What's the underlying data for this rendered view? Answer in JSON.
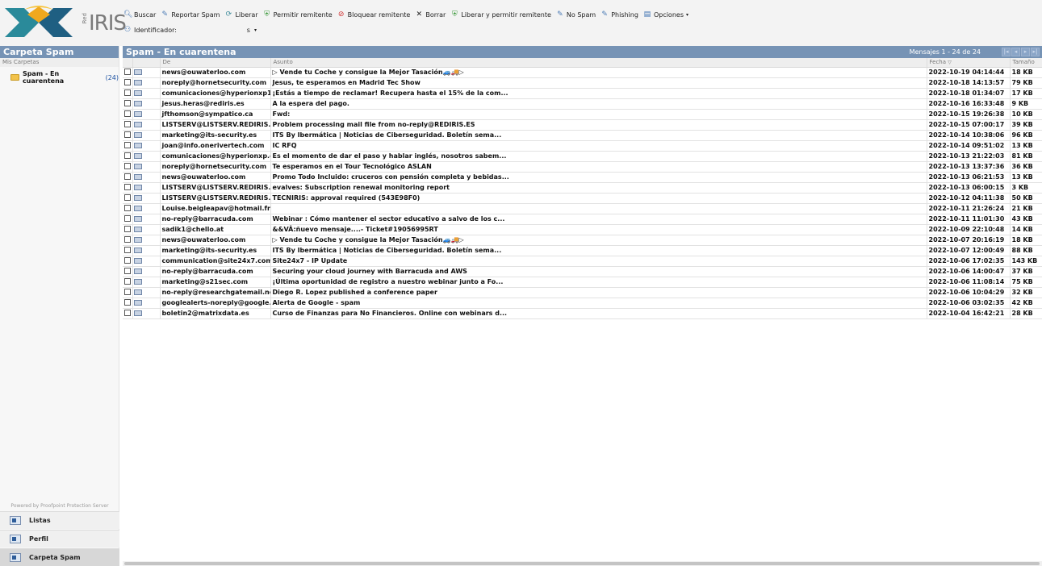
{
  "brand": {
    "name": "IRIS",
    "prefix": "Red"
  },
  "toolbar": {
    "buscar": "Buscar",
    "reportar": "Reportar Spam",
    "liberar": "Liberar",
    "permitir": "Permitir remitente",
    "bloquear": "Bloquear remitente",
    "borrar": "Borrar",
    "liberar_permitir": "Liberar y permitir remitente",
    "no_spam": "No Spam",
    "phishing": "Phishing",
    "opciones": "Opciones",
    "ident_label": "Identificador:",
    "ident_value": "s"
  },
  "left": {
    "title": "Carpeta Spam",
    "subtitle": "Mis Carpetas",
    "folder_name": "Spam - En cuarentena",
    "folder_count": "(24)",
    "powered": "Powered by Proofpoint Protection Server",
    "nav": [
      "Listas",
      "Perfil",
      "Carpeta Spam"
    ]
  },
  "main": {
    "title": "Spam - En cuarentena",
    "count": "Mensajes 1 - 24 de 24",
    "columns": {
      "from": "De",
      "subject": "Asunto",
      "date": "Fecha",
      "size": "Tamaño"
    },
    "rows": [
      {
        "from": "news@ouwaterloo.com",
        "subject": "▷ Vende tu Coche y consigue la Mejor Tasación🚙🚚▷",
        "date": "2022-10-19 04:14:44",
        "size": "18 KB"
      },
      {
        "from": "noreply@hornetsecurity.com",
        "subject": "Jesus,   te esperamos en Madrid Tec Show",
        "date": "2022-10-18 14:13:57",
        "size": "79 KB"
      },
      {
        "from": "comunicaciones@hyperionxp1.com",
        "subject": "¡Estás a tiempo de reclamar! Recupera hasta el 15% de la com...",
        "date": "2022-10-18 01:34:07",
        "size": "17 KB"
      },
      {
        "from": "jesus.heras@rediris.es",
        "subject": "A la espera del pago.",
        "date": "2022-10-16 16:33:48",
        "size": "9 KB"
      },
      {
        "from": "jfthomson@sympatico.ca",
        "subject": "Fwd:",
        "date": "2022-10-15 19:26:38",
        "size": "10 KB"
      },
      {
        "from": "LISTSERV@LISTSERV.REDIRIS.ES",
        "subject": "Problem processing mail file from no-reply@REDIRIS.ES",
        "date": "2022-10-15 07:00:17",
        "size": "39 KB"
      },
      {
        "from": "marketing@its-security.es",
        "subject": "ITS By Ibermática | Noticias de Ciberseguridad. Boletín sema...",
        "date": "2022-10-14 10:38:06",
        "size": "96 KB"
      },
      {
        "from": "joan@info.onerivertech.com",
        "subject": "IC RFQ",
        "date": "2022-10-14 09:51:02",
        "size": "13 KB"
      },
      {
        "from": "comunicaciones@hyperionxp.com",
        "subject": "Es el momento de dar el paso y hablar inglés, nosotros sabem...",
        "date": "2022-10-13 21:22:03",
        "size": "81 KB"
      },
      {
        "from": "noreply@hornetsecurity.com",
        "subject": "Te esperamos en el Tour Tecnológico ASLAN",
        "date": "2022-10-13 13:37:36",
        "size": "36 KB"
      },
      {
        "from": "news@ouwaterloo.com",
        "subject": "Promo Todo Incluido: cruceros con pensión completa y bebidas...",
        "date": "2022-10-13 06:21:53",
        "size": "13 KB"
      },
      {
        "from": "LISTSERV@LISTSERV.REDIRIS.ES",
        "subject": "evalves: Subscription renewal monitoring report",
        "date": "2022-10-13 06:00:15",
        "size": "3 KB"
      },
      {
        "from": "LISTSERV@LISTSERV.REDIRIS.ES",
        "subject": "TECNIRIS: approval required (543E98F0)",
        "date": "2022-10-12 04:11:38",
        "size": "50 KB"
      },
      {
        "from": "Louise.beigleapav@hotmail.fr",
        "subject": "",
        "date": "2022-10-11 21:26:24",
        "size": "21 KB"
      },
      {
        "from": "no-reply@barracuda.com",
        "subject": "Webinar : Cómo mantener el sector educativo a salvo de los c...",
        "date": "2022-10-11 11:01:30",
        "size": "43 KB"
      },
      {
        "from": "sadik1@chello.at",
        "subject": "&&VÂ:ñuevo mensaje....- Ticket#19056995RT",
        "date": "2022-10-09 22:10:48",
        "size": "14 KB"
      },
      {
        "from": "news@ouwaterloo.com",
        "subject": "▷ Vende tu Coche y consigue la Mejor Tasación🚙🚚▷",
        "date": "2022-10-07 20:16:19",
        "size": "18 KB"
      },
      {
        "from": "marketing@its-security.es",
        "subject": "ITS By Ibermática | Noticias de Ciberseguridad. Boletín sema...",
        "date": "2022-10-07 12:00:49",
        "size": "88 KB"
      },
      {
        "from": "communication@site24x7.com",
        "subject": "Site24x7 - IP Update",
        "date": "2022-10-06 17:02:35",
        "size": "143 KB"
      },
      {
        "from": "no-reply@barracuda.com",
        "subject": "Securing your cloud journey with Barracuda and AWS",
        "date": "2022-10-06 14:00:47",
        "size": "37 KB"
      },
      {
        "from": "marketing@s21sec.com",
        "subject": "¡Última oportunidad de registro a nuestro webinar junto a Fo...",
        "date": "2022-10-06 11:08:14",
        "size": "75 KB"
      },
      {
        "from": "no-reply@researchgatemail.net",
        "subject": "Diego R. Lopez published a conference paper",
        "date": "2022-10-06 10:04:29",
        "size": "32 KB"
      },
      {
        "from": "googlealerts-noreply@google.com",
        "subject": "Alerta de Google - spam",
        "date": "2022-10-06 03:02:35",
        "size": "42 KB"
      },
      {
        "from": "boletin2@matrixdata.es",
        "subject": "Curso de Finanzas para No Financieros. Online con webinars d...",
        "date": "2022-10-04 16:42:21",
        "size": "28 KB"
      }
    ]
  },
  "colors": {
    "header_bar": "#7693b5",
    "link": "#1a4fa0",
    "panel_bg": "#f7f7f7"
  },
  "icons": {
    "search": "magnifier-icon",
    "report": "pencil-icon",
    "release": "release-icon",
    "allow": "shield-icon",
    "block": "block-icon",
    "delete": "x-icon",
    "options": "options-icon"
  }
}
